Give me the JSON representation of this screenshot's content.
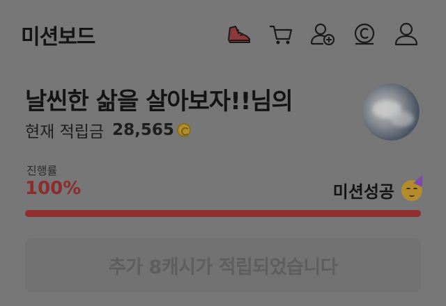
{
  "header": {
    "title": "미션보드",
    "icons": [
      "sneaker-icon",
      "cart-icon",
      "add-user-icon",
      "coin-icon",
      "profile-icon"
    ]
  },
  "user": {
    "greeting": "날씬한 삶을 살아보자!!님의",
    "points_label": "현재 적립금",
    "points_value": "28,565"
  },
  "progress": {
    "label": "진행률",
    "value_text": "100%",
    "fraction": 1.0,
    "status": "미션성공"
  },
  "cta": {
    "label": "추가 8캐시가 적립되었습니다"
  },
  "colors": {
    "accent": "#8f2f2f",
    "overlay_bg": "#777777"
  }
}
